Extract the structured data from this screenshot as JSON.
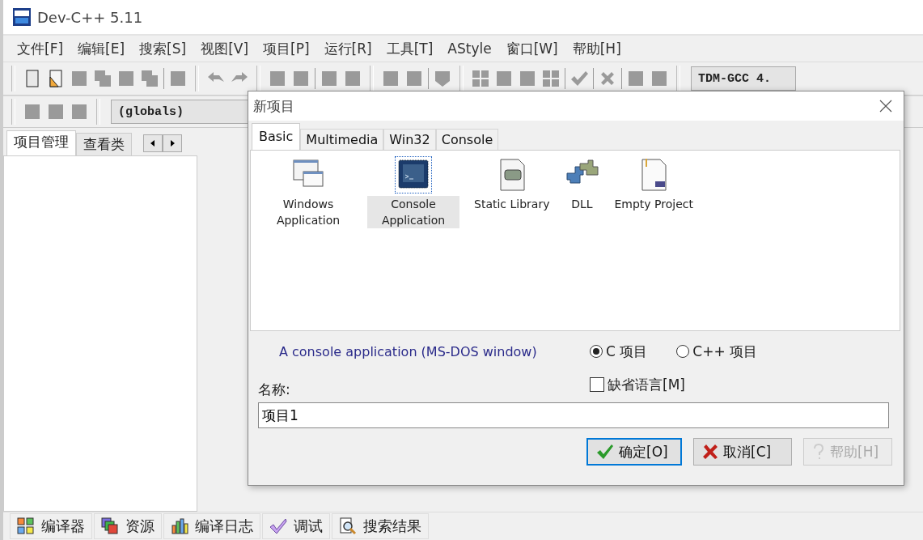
{
  "window": {
    "title": "Dev-C++ 5.11"
  },
  "menu": [
    "文件[F]",
    "编辑[E]",
    "搜索[S]",
    "视图[V]",
    "项目[P]",
    "运行[R]",
    "工具[T]",
    "AStyle",
    "窗口[W]",
    "帮助[H]"
  ],
  "toolbar": {
    "compiler": "TDM-GCC 4."
  },
  "scope_box": {
    "value": "(globals)"
  },
  "left_panel": {
    "tabs": [
      {
        "label": "项目管理",
        "selected": true
      },
      {
        "label": "查看类",
        "selected": false
      }
    ]
  },
  "bottom_tabs": [
    {
      "label": "编译器",
      "kind": "grid"
    },
    {
      "label": "资源",
      "kind": "layers"
    },
    {
      "label": "编译日志",
      "kind": "bars"
    },
    {
      "label": "调试",
      "kind": "check"
    },
    {
      "label": "搜索结果",
      "kind": "search"
    }
  ],
  "dialog": {
    "title": "新项目",
    "tabs": [
      {
        "label": "Basic",
        "selected": true
      },
      {
        "label": "Multimedia",
        "selected": false
      },
      {
        "label": "Win32",
        "selected": false
      },
      {
        "label": "Console",
        "selected": false
      }
    ],
    "templates": [
      {
        "label": "Windows Application",
        "kind": "windows",
        "selected": false
      },
      {
        "label": "Console Application",
        "kind": "console",
        "selected": true
      },
      {
        "label": "Static Library",
        "kind": "library",
        "selected": false
      },
      {
        "label": "DLL",
        "kind": "dll",
        "selected": false
      },
      {
        "label": "Empty Project",
        "kind": "empty",
        "selected": false
      }
    ],
    "description": "A console application (MS-DOS window)",
    "language": [
      {
        "label": "C 项目",
        "selected": true
      },
      {
        "label": "C++ 项目",
        "selected": false
      }
    ],
    "default_language": {
      "label": "缺省语言[M]",
      "checked": false
    },
    "name": {
      "label": "名称:",
      "value": "项目1"
    },
    "buttons": [
      {
        "label": "确定[O]",
        "kind": "ok",
        "disabled": false
      },
      {
        "label": "取消[C]",
        "kind": "cancel",
        "disabled": false
      },
      {
        "label": "帮助[H]",
        "kind": "help",
        "disabled": true
      }
    ]
  }
}
